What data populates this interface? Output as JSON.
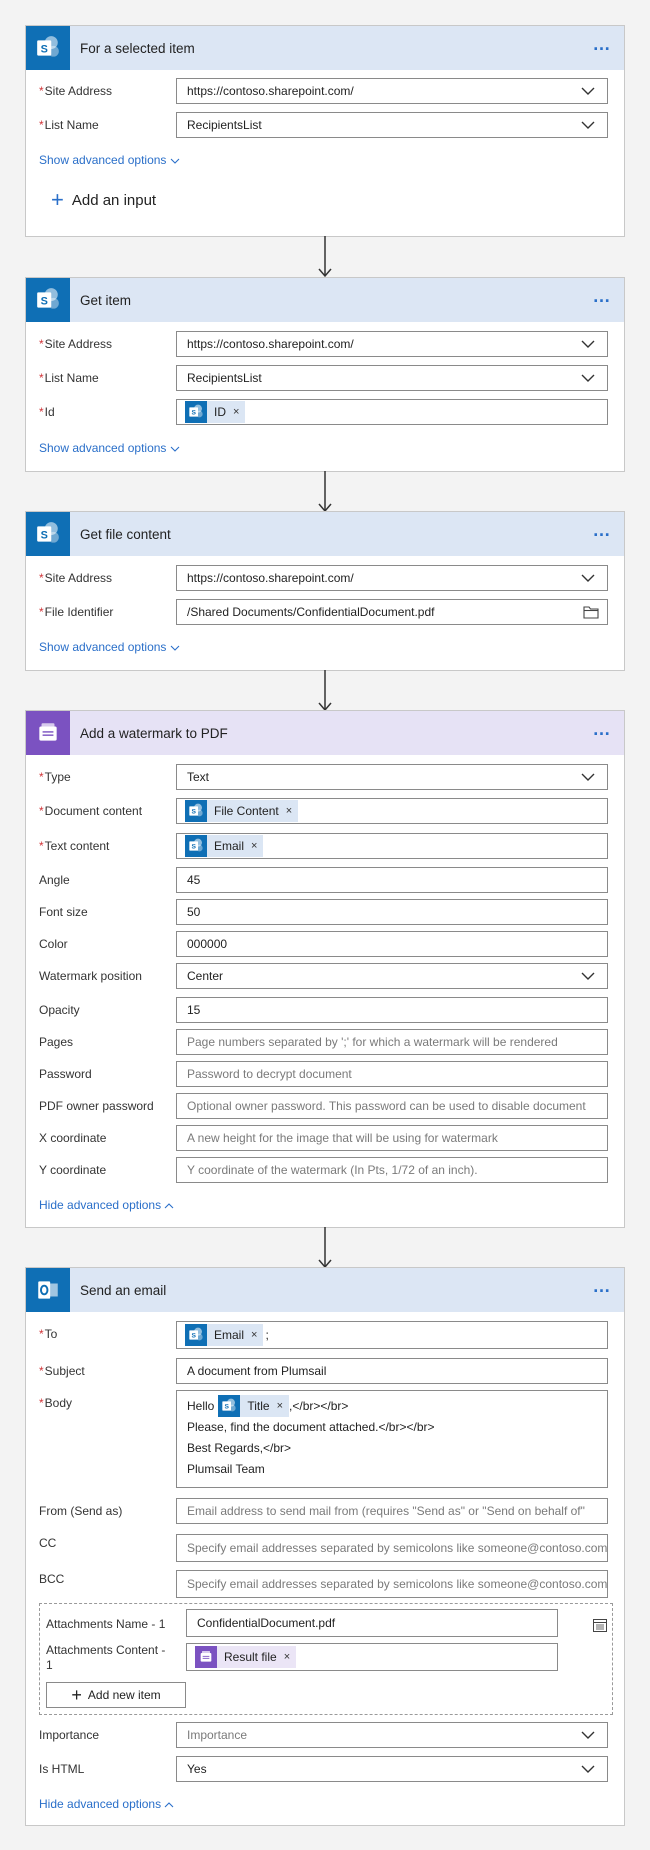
{
  "card1": {
    "title": "For a selected item",
    "more": "…",
    "site_label": "Site Address",
    "site_value": "https://contoso.sharepoint.com/",
    "list_label": "List Name",
    "list_value": "RecipientsList",
    "advanced": "Show advanced options",
    "add_input": "Add an input"
  },
  "card2": {
    "title": "Get item",
    "more": "…",
    "site_label": "Site Address",
    "site_value": "https://contoso.sharepoint.com/",
    "list_label": "List Name",
    "list_value": "RecipientsList",
    "id_label": "Id",
    "id_token": "ID",
    "advanced": "Show advanced options"
  },
  "card3": {
    "title": "Get file content",
    "more": "…",
    "site_label": "Site Address",
    "site_value": "https://contoso.sharepoint.com/",
    "file_label": "File Identifier",
    "file_value": "/Shared Documents/ConfidentialDocument.pdf",
    "advanced": "Show advanced options"
  },
  "card4": {
    "title": "Add a watermark to PDF",
    "more": "…",
    "type_label": "Type",
    "type_value": "Text",
    "doc_label": "Document content",
    "doc_token": "File Content",
    "text_label": "Text content",
    "text_token": "Email",
    "angle_label": "Angle",
    "angle_value": "45",
    "fontsize_label": "Font size",
    "fontsize_value": "50",
    "color_label": "Color",
    "color_value": "000000",
    "position_label": "Watermark position",
    "position_value": "Center",
    "opacity_label": "Opacity",
    "opacity_value": "15",
    "pages_label": "Pages",
    "pages_placeholder": "Page numbers separated by ';' for which a watermark will be rendered",
    "password_label": "Password",
    "password_placeholder": "Password to decrypt document",
    "owner_label": "PDF owner password",
    "owner_placeholder": "Optional owner password. This password can be used to disable document",
    "x_label": "X coordinate",
    "x_placeholder": "A new height for the image that will be using for watermark",
    "y_label": "Y coordinate",
    "y_placeholder": "Y coordinate of the watermark (In Pts, 1/72 of an inch).",
    "advanced": "Hide advanced options"
  },
  "card5": {
    "title": "Send an email",
    "more": "…",
    "to_label": "To",
    "to_token": "Email",
    "to_sep": ";",
    "subject_label": "Subject",
    "subject_value": "A document from Plumsail",
    "body_label": "Body",
    "body_hello": "Hello",
    "body_token": "Title",
    "body_line1_tail": ",</br></br>",
    "body_line2": "Please, find the document attached.</br></br>",
    "body_line3": "Best Regards,</br>",
    "body_line4": "Plumsail Team",
    "from_label": "From (Send as)",
    "from_placeholder": "Email address to send mail from (requires \"Send as\" or \"Send on behalf of\"",
    "cc_label": "CC",
    "cc_placeholder": "Specify email addresses separated by semicolons like someone@contoso.com",
    "bcc_label": "BCC",
    "bcc_placeholder": "Specify email addresses separated by semicolons like someone@contoso.com",
    "att_name_label": "Attachments Name - 1",
    "att_name_value": "ConfidentialDocument.pdf",
    "att_content_label_a": "Attachments Content -",
    "att_content_label_b": "1",
    "att_content_token": "Result file",
    "add_item": "Add new item",
    "importance_label": "Importance",
    "importance_value": "Importance",
    "html_label": "Is HTML",
    "html_value": "Yes",
    "advanced": "Hide advanced options"
  },
  "icons": {
    "required": "*",
    "token_remove": "×"
  },
  "colors": {
    "accent": "#2a6fc9",
    "sharepoint": "#0f6fb5",
    "plumsail": "#7b52c1",
    "required": "#d13438",
    "header_blue": "#dce6f4",
    "header_purple": "#e6e2f5"
  }
}
